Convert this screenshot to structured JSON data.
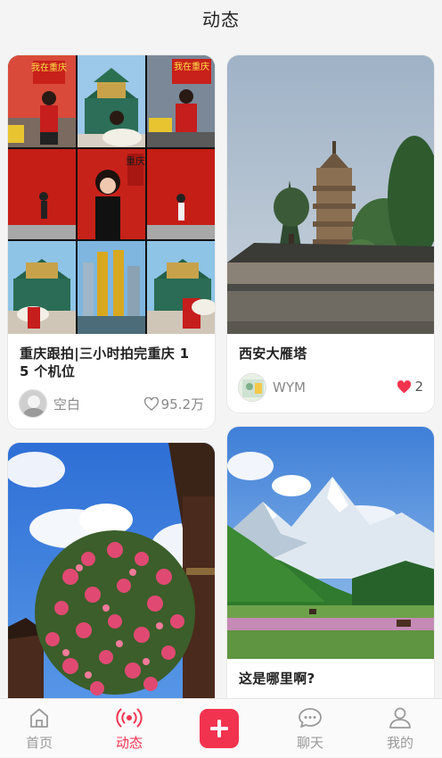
{
  "header": {
    "title": "动态"
  },
  "feed": {
    "cards": [
      {
        "title": "重庆跟拍|三小时拍完重庆 1 5 个机位",
        "author": "空白",
        "likes": "95.2万",
        "liked": false
      },
      {
        "title": "西安大雁塔",
        "author": "WYM",
        "likes": "2",
        "liked": true
      },
      {
        "title": "",
        "author": "",
        "likes": "",
        "liked": false
      },
      {
        "title": "这是哪里啊?",
        "author": "",
        "likes": "",
        "liked": false
      }
    ],
    "collage_text": {
      "sign_1": "我在重庆",
      "sign_2": "我在重庆",
      "wall": "重庆"
    }
  },
  "tabbar": {
    "tabs": [
      {
        "label": "首页",
        "icon": "home-icon",
        "active": false
      },
      {
        "label": "动态",
        "icon": "broadcast-icon",
        "active": true
      },
      {
        "label": "",
        "icon": "plus-icon",
        "active": false
      },
      {
        "label": "聊天",
        "icon": "chat-bubble-icon",
        "active": false
      },
      {
        "label": "我的",
        "icon": "user-icon",
        "active": false
      }
    ]
  },
  "colors": {
    "accent": "#f2334f",
    "like": "#f2334f",
    "muted": "#9a9a9a"
  }
}
